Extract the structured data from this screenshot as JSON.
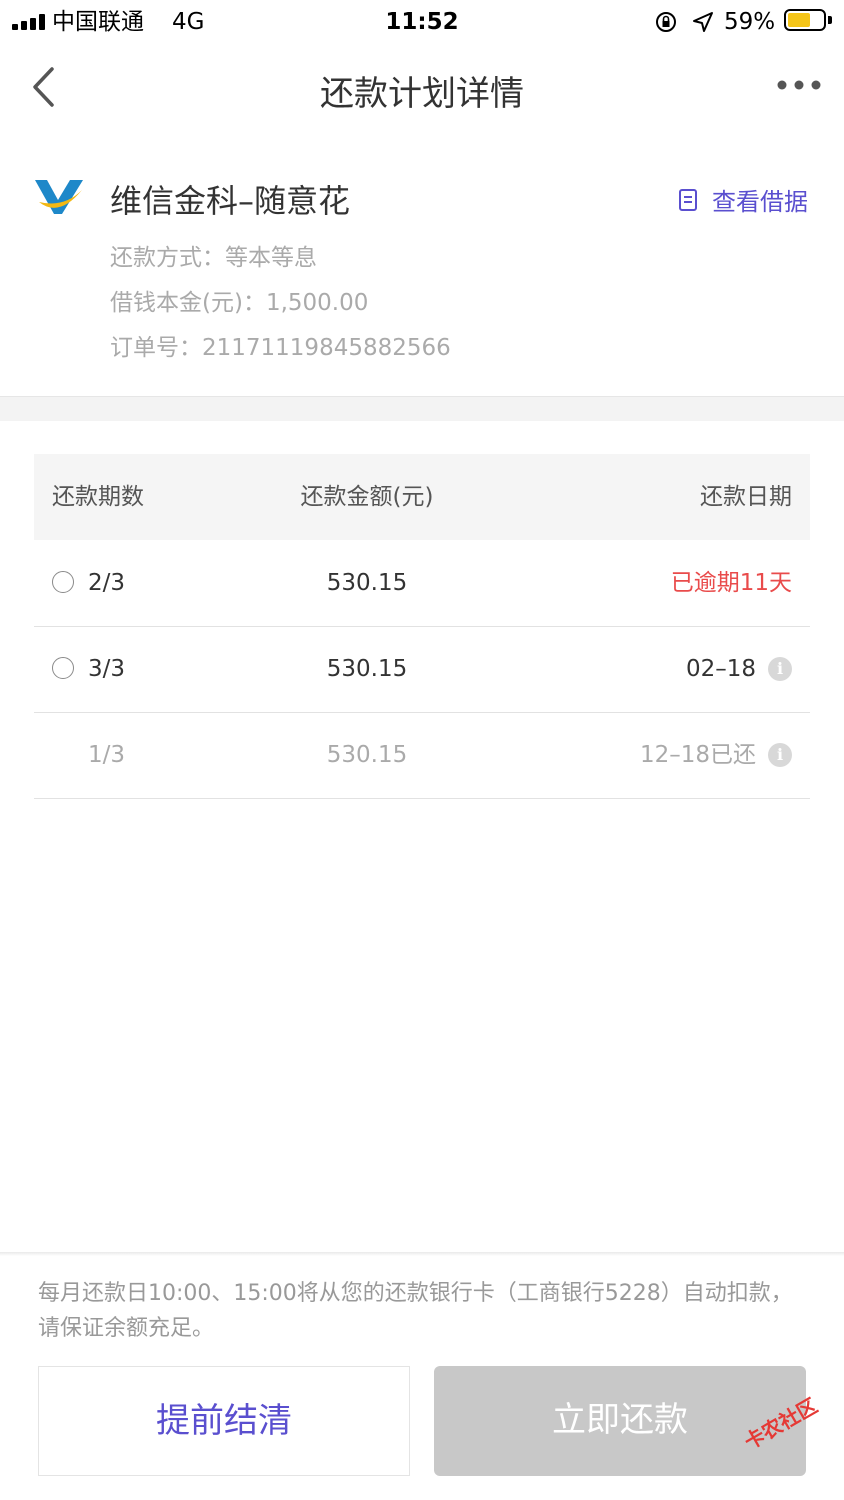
{
  "status_bar": {
    "carrier": "中国联通",
    "network": "4G",
    "time": "11:52",
    "battery": "59%"
  },
  "nav": {
    "title": "还款计划详情",
    "back_icon": "chevron-left-icon",
    "more_icon": "more-dots-icon"
  },
  "product": {
    "name": "维信金科–随意花",
    "repay_method": "还款方式：等本等息",
    "principal": "借钱本金(元)：1,500.00",
    "order_no": "订单号：21171119845882566",
    "receipt_link": "查看借据",
    "logo_colors": {
      "blue": "#1e88c9",
      "yellow": "#f3b814"
    },
    "link_color": "#5a4fcf"
  },
  "table": {
    "headers": {
      "period": "还款期数",
      "amount": "还款金额(元)",
      "date": "还款日期"
    },
    "rows": [
      {
        "period": "2/3",
        "amount": "530.15",
        "date": "已逾期11天"
      },
      {
        "period": "3/3",
        "amount": "530.15",
        "date": "02–18"
      },
      {
        "period": "1/3",
        "amount": "530.15",
        "date": "12–18已还"
      }
    ],
    "overdue_color": "#e94b4b"
  },
  "footer": {
    "notice": "每月还款日10:00、15:00将从您的还款银行卡（工商银行5228）自动扣款，请保证余额充足。",
    "settle_button": "提前结清",
    "pay_button": "立即还款"
  },
  "watermark": "卡农社区"
}
